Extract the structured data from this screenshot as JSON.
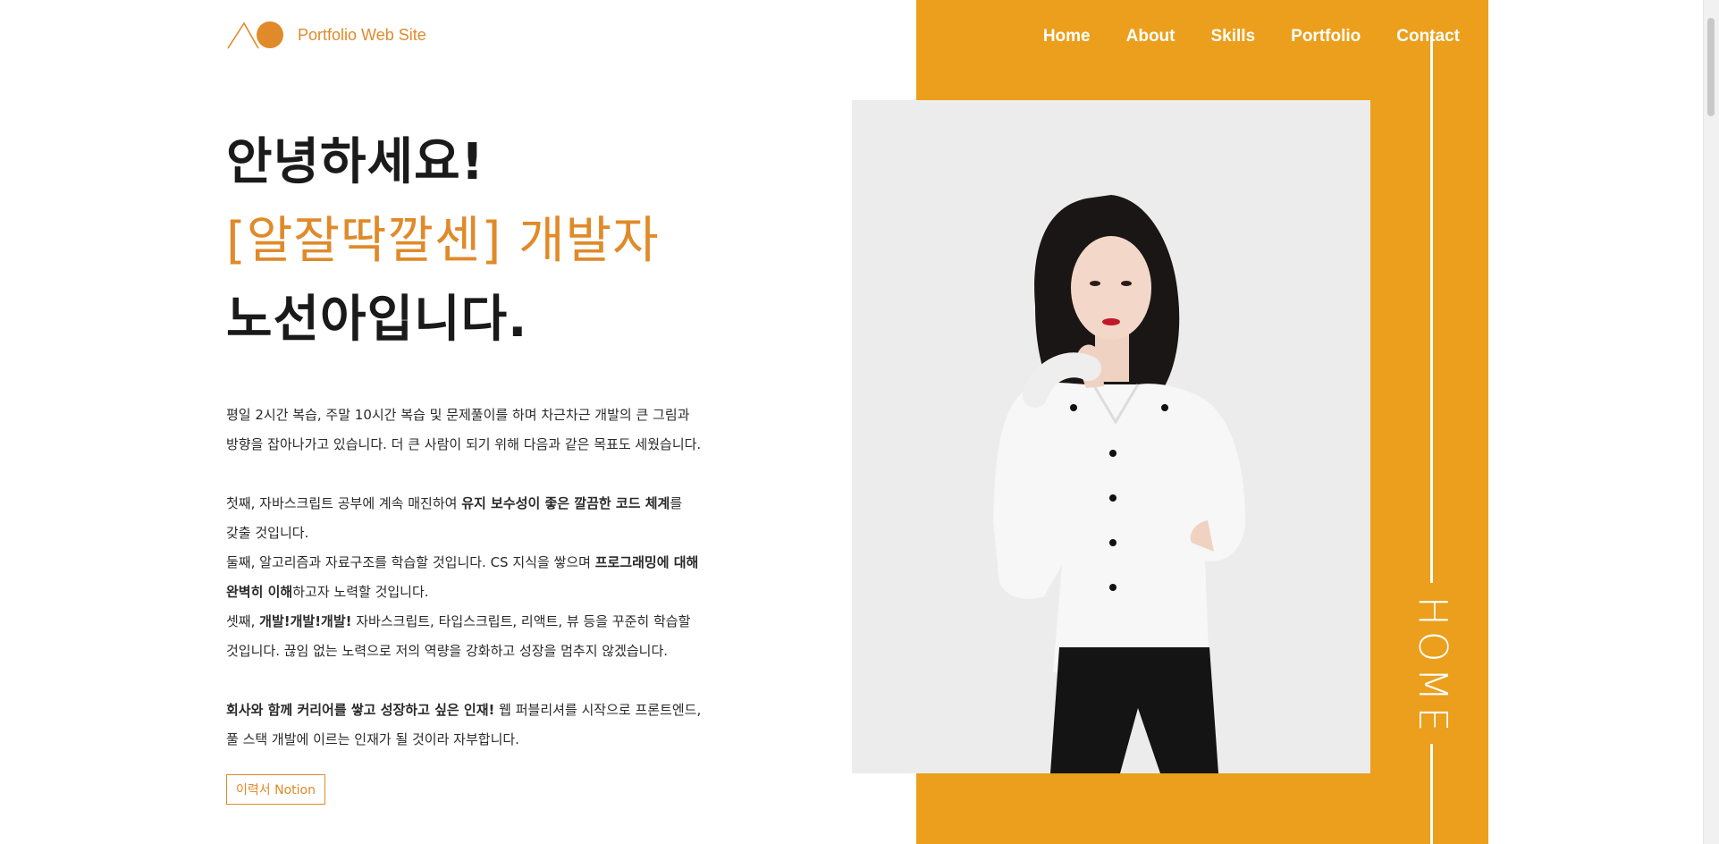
{
  "logo": {
    "text": "Portfolio Web Site"
  },
  "nav": [
    "Home",
    "About",
    "Skills",
    "Portfolio",
    "Contact"
  ],
  "hero": {
    "line1": "안녕하세요!",
    "line2": "[알잘딱깔센] 개발자",
    "line3_underlined": "노선아",
    "line3_rest": "입니다."
  },
  "intro": {
    "line1": "평일 2시간 복습, 주말 10시간 복습 및 문제풀이를 하며 차근차근 개발의 큰 그림과",
    "line2": "방향을 잡아나가고 있습니다. 더 큰 사람이 되기 위해 다음과 같은 목표도 세웠습니다."
  },
  "goals": [
    {
      "label": "첫째",
      "parts": [
        ", 자바스크립트 공부에 계속 매진하여 ",
        "유지 보수성이 좋은 깔끔한 코드 체계",
        "를"
      ],
      "line2": "갖출 것입니다."
    },
    {
      "label": "둘째",
      "parts": [
        ", 알고리즘과 자료구조를 학습할 것입니다. CS 지식을 쌓으며 ",
        "프로그래밍에 대해"
      ],
      "line2_bold": "완벽히 이해",
      "line2_rest": "하고자 노력할 것입니다."
    },
    {
      "label": "셋째",
      "parts": [
        ", ",
        "개발!개발!개발!",
        " 자바스크립트, 타입스크립트, 리액트, 뷰 등을 꾸준히 학습할"
      ],
      "line2": "것입니다. 끊임 없는 노력으로 저의 역량을 강화하고 성장을 멈추지 않겠습니다."
    }
  ],
  "closing": {
    "highlight": "회사와 함께 커리어를 쌓고 성장하고 싶은 인재!",
    "rest": " 웹 퍼블리셔를 시작으로 프론트엔드,",
    "line2": "풀 스택 개발에 이르는 인재가 될 것이라 자부합니다."
  },
  "button": {
    "label": "이력서 Notion"
  },
  "side_label": "HOME",
  "colors": {
    "accent": "#EB9F1C",
    "accent_text": "#E08A2A"
  }
}
